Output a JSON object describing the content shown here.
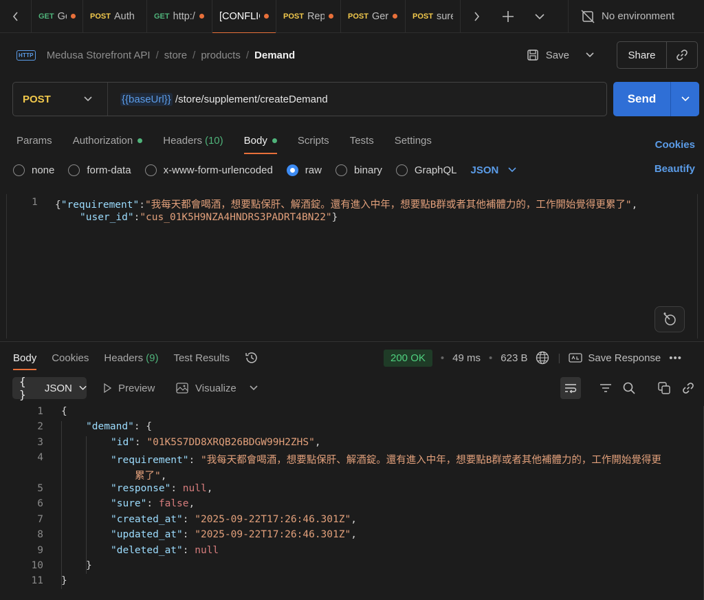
{
  "tabs": [
    {
      "method": "GET",
      "name": "Get a",
      "method_color": "#4fb37a",
      "modified": true
    },
    {
      "method": "POST",
      "name": "Auth",
      "method_color": "#f2c94c",
      "modified": false
    },
    {
      "method": "GET",
      "name": "http:/",
      "method_color": "#4fb37a",
      "modified": true
    },
    {
      "method": "",
      "name": "[CONFLIC",
      "method_color": "#ffffff",
      "modified": true
    },
    {
      "method": "POST",
      "name": "Rep",
      "method_color": "#f2c94c",
      "modified": true
    },
    {
      "method": "POST",
      "name": "Ger",
      "method_color": "#f2c94c",
      "modified": true
    },
    {
      "method": "POST",
      "name": "sure",
      "method_color": "#f2c94c",
      "modified": false
    }
  ],
  "environment": {
    "label": "No environment"
  },
  "breadcrumb": {
    "badge": "HTTP",
    "items": [
      "Medusa Storefront API",
      "store",
      "products"
    ],
    "current": "Demand"
  },
  "actions": {
    "save": "Save",
    "share": "Share"
  },
  "request": {
    "method": "POST",
    "url_var": "{{baseUrl}}",
    "url_path": "/store/supplement/createDemand",
    "send": "Send"
  },
  "request_tabs": [
    {
      "label": "Params",
      "count": "",
      "dot": false
    },
    {
      "label": "Authorization",
      "count": "",
      "dot": true
    },
    {
      "label": "Headers",
      "count": "(10)",
      "dot": false
    },
    {
      "label": "Body",
      "count": "",
      "dot": true
    },
    {
      "label": "Scripts",
      "count": "",
      "dot": false
    },
    {
      "label": "Tests",
      "count": "",
      "dot": false
    },
    {
      "label": "Settings",
      "count": "",
      "dot": false
    }
  ],
  "cookies_link": "Cookies",
  "body_types": [
    "none",
    "form-data",
    "x-www-form-urlencoded",
    "raw",
    "binary",
    "GraphQL"
  ],
  "body_type_selected": "raw",
  "body_format": "JSON",
  "beautify": "Beautify",
  "request_body": {
    "line_number": "1",
    "line1_open": "{",
    "key1": "\"requirement\"",
    "value1": "\"我每天都會喝酒，想要點保肝、解酒錠。還有進入中年，想要點B群或者其他補體力的，工作開始覺得更累了\"",
    "key2": "\"user_id\"",
    "value2": "\"cus_01K5H9NZA4HNDRS3PADRT4BN22\""
  },
  "response_tabs": [
    {
      "label": "Body",
      "count": ""
    },
    {
      "label": "Cookies",
      "count": ""
    },
    {
      "label": "Headers",
      "count": "(9)"
    },
    {
      "label": "Test Results",
      "count": ""
    }
  ],
  "response_meta": {
    "status": "200 OK",
    "time": "49 ms",
    "size": "623 B",
    "save_response": "Save Response"
  },
  "response_toolbar": {
    "format": "JSON",
    "preview": "Preview",
    "visualize": "Visualize"
  },
  "response_lines": [
    {
      "n": "1",
      "indent": 0,
      "parts": [
        [
          "punc",
          "{"
        ]
      ]
    },
    {
      "n": "2",
      "indent": 1,
      "parts": [
        [
          "key",
          "\"demand\""
        ],
        [
          "punc",
          ": {"
        ]
      ]
    },
    {
      "n": "3",
      "indent": 2,
      "parts": [
        [
          "key",
          "\"id\""
        ],
        [
          "punc",
          ": "
        ],
        [
          "str",
          "\"01K5S7DD8XRQB26BDGW99H2ZHS\""
        ],
        [
          "punc",
          ","
        ]
      ]
    },
    {
      "n": "4",
      "indent": 2,
      "parts": [
        [
          "key",
          "\"requirement\""
        ],
        [
          "punc",
          ": "
        ],
        [
          "str",
          "\"我每天都會喝酒，想要點保肝、解酒錠。還有進入中年，想要點B群或者其他補體力的，工作開始覺得更"
        ]
      ]
    },
    {
      "n": "",
      "indent": 3,
      "parts": [
        [
          "str",
          "累了\""
        ],
        [
          "punc",
          ","
        ]
      ]
    },
    {
      "n": "5",
      "indent": 2,
      "parts": [
        [
          "key",
          "\"response\""
        ],
        [
          "punc",
          ": "
        ],
        [
          "kw",
          "null"
        ],
        [
          "punc",
          ","
        ]
      ]
    },
    {
      "n": "6",
      "indent": 2,
      "parts": [
        [
          "key",
          "\"sure\""
        ],
        [
          "punc",
          ": "
        ],
        [
          "kw",
          "false"
        ],
        [
          "punc",
          ","
        ]
      ]
    },
    {
      "n": "7",
      "indent": 2,
      "parts": [
        [
          "key",
          "\"created_at\""
        ],
        [
          "punc",
          ": "
        ],
        [
          "str",
          "\"2025-09-22T17:26:46.301Z\""
        ],
        [
          "punc",
          ","
        ]
      ]
    },
    {
      "n": "8",
      "indent": 2,
      "parts": [
        [
          "key",
          "\"updated_at\""
        ],
        [
          "punc",
          ": "
        ],
        [
          "str",
          "\"2025-09-22T17:26:46.301Z\""
        ],
        [
          "punc",
          ","
        ]
      ]
    },
    {
      "n": "9",
      "indent": 2,
      "parts": [
        [
          "key",
          "\"deleted_at\""
        ],
        [
          "punc",
          ": "
        ],
        [
          "kw",
          "null"
        ]
      ]
    },
    {
      "n": "10",
      "indent": 1,
      "parts": [
        [
          "punc",
          "}"
        ]
      ]
    },
    {
      "n": "11",
      "indent": 0,
      "parts": [
        [
          "punc",
          "}"
        ]
      ]
    }
  ],
  "colors": {
    "accent": "#e8703a",
    "link": "#5b9ce8",
    "send": "#2f6fd6",
    "status_ok": "#4fd17f",
    "json_key": "#9cdcfe",
    "json_string": "#e2a07b",
    "json_keyword": "#d77d7d"
  }
}
